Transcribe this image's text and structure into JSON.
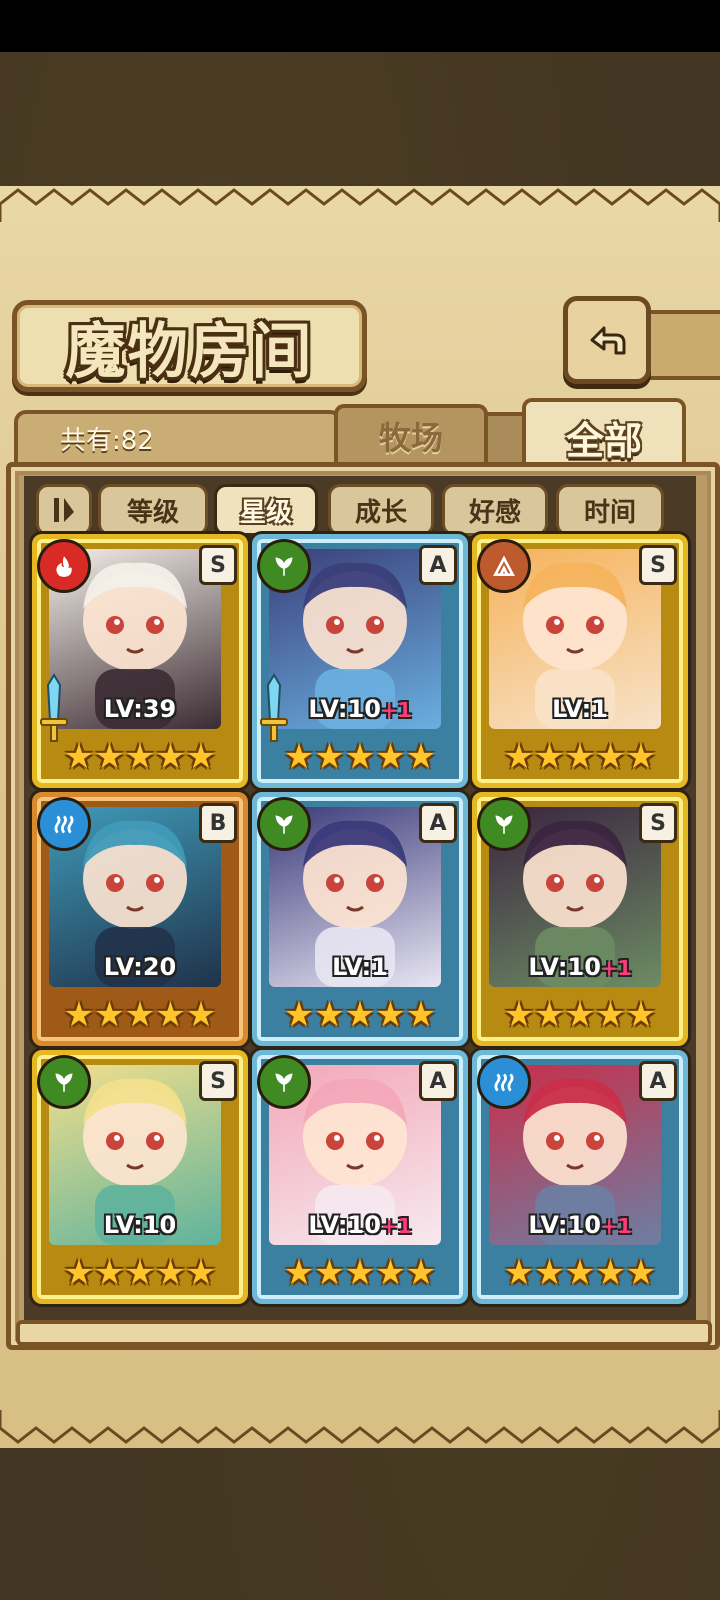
{
  "title": "魔物房间",
  "count_label": "共有:82",
  "tabs": [
    {
      "label": "牧场",
      "active": false
    },
    {
      "label": "全部",
      "active": true
    }
  ],
  "sort_buttons": [
    {
      "label": "等级",
      "active": false
    },
    {
      "label": "星级",
      "active": true
    },
    {
      "label": "成长",
      "active": false
    },
    {
      "label": "好感",
      "active": false
    },
    {
      "label": "时间",
      "active": false
    }
  ],
  "cards": [
    {
      "level": "LV:39",
      "plus": "",
      "rank": "S",
      "element": "fire",
      "frame": "gold",
      "stars": 5,
      "weapon": true
    },
    {
      "level": "LV:10",
      "plus": "+1",
      "rank": "A",
      "element": "wood",
      "frame": "blue",
      "stars": 5,
      "weapon": true
    },
    {
      "level": "LV:1",
      "plus": "",
      "rank": "S",
      "element": "earth",
      "frame": "gold",
      "stars": 5,
      "weapon": false
    },
    {
      "level": "LV:20",
      "plus": "",
      "rank": "B",
      "element": "water",
      "frame": "orange",
      "stars": 5,
      "weapon": false
    },
    {
      "level": "LV:1",
      "plus": "",
      "rank": "A",
      "element": "wood",
      "frame": "blue",
      "stars": 5,
      "weapon": false
    },
    {
      "level": "LV:10",
      "plus": "+1",
      "rank": "S",
      "element": "wood",
      "frame": "gold",
      "stars": 5,
      "weapon": false
    },
    {
      "level": "LV:10",
      "plus": "",
      "rank": "S",
      "element": "wood",
      "frame": "gold",
      "stars": 5,
      "weapon": false
    },
    {
      "level": "LV:10",
      "plus": "+1",
      "rank": "A",
      "element": "wood",
      "frame": "blue",
      "stars": 5,
      "weapon": false
    },
    {
      "level": "LV:10",
      "plus": "+1",
      "rank": "A",
      "element": "water",
      "frame": "blue",
      "stars": 5,
      "weapon": false
    }
  ],
  "colors": {
    "parchment": "#dcc58e",
    "frame_brown": "#7a5426",
    "star_yellow": "#ffc52a",
    "plus_pink": "#ff3c7a"
  }
}
